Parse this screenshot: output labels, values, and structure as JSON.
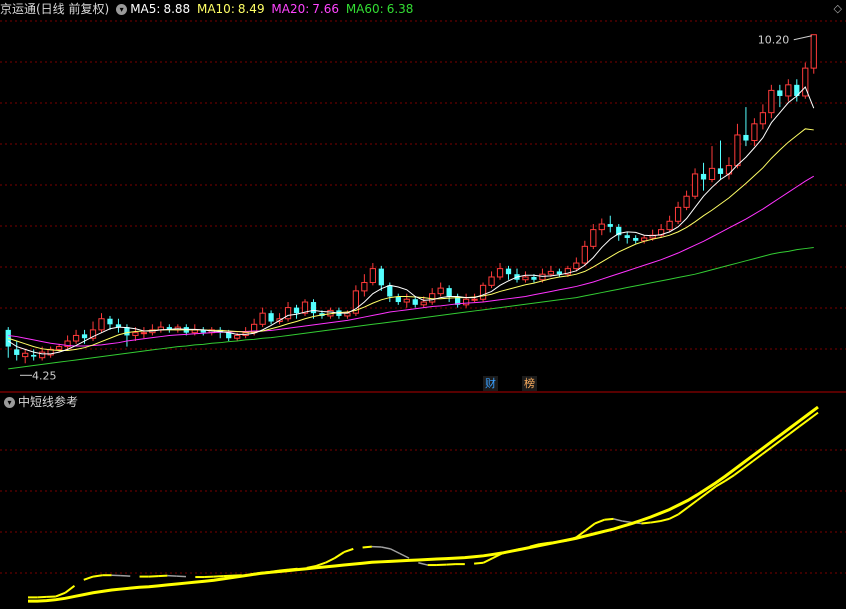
{
  "header": {
    "title": "京运通(日线 前复权)",
    "ma5_label": "MA5:",
    "ma5_value": "8.88",
    "ma10_label": "MA10:",
    "ma10_value": "8.49",
    "ma20_label": "MA20:",
    "ma20_value": "7.66",
    "ma60_label": "MA60:",
    "ma60_value": "6.38"
  },
  "colors": {
    "background": "#000000",
    "up": "#ff3b3b",
    "down": "#54ffff",
    "ma5": "#ffffff",
    "ma10": "#ffff66",
    "ma20": "#ff33ff",
    "ma60": "#33cc33",
    "grid": "#7a0000",
    "indicator_main": "#ffff00",
    "indicator_alt": "#a0a0a0",
    "badge_cai": "#3aa0ff",
    "badge_bang": "#ffb060"
  },
  "price_annotations": {
    "high": "10.20",
    "low": "4.25"
  },
  "badges": {
    "cai": "财",
    "bang": "榜"
  },
  "sub_panel": {
    "title": "中短线参考"
  },
  "icons": {
    "header_toggle": "chevron-down-icon",
    "settings": "diamond-icon",
    "up_arrow": "up-arrow-icon"
  },
  "chart_data": {
    "type": "candlestick",
    "y_range": [
      4.0,
      10.5
    ],
    "candles": [
      [
        4.9,
        4.6,
        4.95,
        4.4
      ],
      [
        4.55,
        4.45,
        4.7,
        4.35
      ],
      [
        4.42,
        4.48,
        4.55,
        4.3
      ],
      [
        4.45,
        4.42,
        4.55,
        4.35
      ],
      [
        4.4,
        4.5,
        4.6,
        4.35
      ],
      [
        4.45,
        4.55,
        4.6,
        4.4
      ],
      [
        4.55,
        4.6,
        4.65,
        4.5
      ],
      [
        4.6,
        4.7,
        4.8,
        4.55
      ],
      [
        4.7,
        4.8,
        4.9,
        4.65
      ],
      [
        4.82,
        4.75,
        4.9,
        4.65
      ],
      [
        4.75,
        4.9,
        5.05,
        4.7
      ],
      [
        4.9,
        5.1,
        5.2,
        4.85
      ],
      [
        5.1,
        5.0,
        5.15,
        4.9
      ],
      [
        5.0,
        4.95,
        5.1,
        4.85
      ],
      [
        4.95,
        4.8,
        5.0,
        4.6
      ],
      [
        4.8,
        4.85,
        4.95,
        4.7
      ],
      [
        4.85,
        4.85,
        4.95,
        4.75
      ],
      [
        4.85,
        4.9,
        5.0,
        4.8
      ],
      [
        4.9,
        4.95,
        5.05,
        4.85
      ],
      [
        4.95,
        4.9,
        5.0,
        4.85
      ],
      [
        4.9,
        4.95,
        5.0,
        4.85
      ],
      [
        4.95,
        4.85,
        5.0,
        4.8
      ],
      [
        4.85,
        4.9,
        5.0,
        4.8
      ],
      [
        4.9,
        4.85,
        4.95,
        4.8
      ],
      [
        4.85,
        4.9,
        4.95,
        4.8
      ],
      [
        4.9,
        4.85,
        4.95,
        4.75
      ],
      [
        4.85,
        4.75,
        4.9,
        4.7
      ],
      [
        4.75,
        4.8,
        4.85,
        4.7
      ],
      [
        4.8,
        4.85,
        4.95,
        4.75
      ],
      [
        4.85,
        5.0,
        5.1,
        4.8
      ],
      [
        5.0,
        5.2,
        5.3,
        4.95
      ],
      [
        5.2,
        5.05,
        5.25,
        5.0
      ],
      [
        5.05,
        5.1,
        5.2,
        5.0
      ],
      [
        5.1,
        5.3,
        5.4,
        5.05
      ],
      [
        5.3,
        5.2,
        5.35,
        5.1
      ],
      [
        5.2,
        5.4,
        5.45,
        5.15
      ],
      [
        5.4,
        5.2,
        5.45,
        5.1
      ],
      [
        5.2,
        5.15,
        5.25,
        5.1
      ],
      [
        5.15,
        5.25,
        5.3,
        5.1
      ],
      [
        5.25,
        5.15,
        5.3,
        5.1
      ],
      [
        5.15,
        5.2,
        5.25,
        5.1
      ],
      [
        5.2,
        5.6,
        5.7,
        5.15
      ],
      [
        5.6,
        5.75,
        5.9,
        5.5
      ],
      [
        5.75,
        6.0,
        6.1,
        5.7
      ],
      [
        6.0,
        5.7,
        6.05,
        5.6
      ],
      [
        5.7,
        5.5,
        5.75,
        5.4
      ],
      [
        5.5,
        5.4,
        5.55,
        5.35
      ],
      [
        5.4,
        5.45,
        5.55,
        5.3
      ],
      [
        5.45,
        5.35,
        5.5,
        5.3
      ],
      [
        5.35,
        5.4,
        5.5,
        5.3
      ],
      [
        5.4,
        5.55,
        5.65,
        5.35
      ],
      [
        5.55,
        5.65,
        5.75,
        5.5
      ],
      [
        5.65,
        5.5,
        5.7,
        5.4
      ],
      [
        5.5,
        5.35,
        5.55,
        5.3
      ],
      [
        5.35,
        5.45,
        5.55,
        5.3
      ],
      [
        5.45,
        5.45,
        5.55,
        5.4
      ],
      [
        5.45,
        5.7,
        5.75,
        5.4
      ],
      [
        5.7,
        5.85,
        5.95,
        5.65
      ],
      [
        5.85,
        6.0,
        6.1,
        5.8
      ],
      [
        6.0,
        5.9,
        6.05,
        5.8
      ],
      [
        5.9,
        5.8,
        6.0,
        5.75
      ],
      [
        5.8,
        5.85,
        5.95,
        5.75
      ],
      [
        5.85,
        5.8,
        5.9,
        5.75
      ],
      [
        5.8,
        5.9,
        6.0,
        5.75
      ],
      [
        5.9,
        5.95,
        6.05,
        5.85
      ],
      [
        5.95,
        5.9,
        6.0,
        5.85
      ],
      [
        5.9,
        6.0,
        6.05,
        5.85
      ],
      [
        6.0,
        6.1,
        6.2,
        5.95
      ],
      [
        6.1,
        6.4,
        6.5,
        6.05
      ],
      [
        6.4,
        6.7,
        6.8,
        6.35
      ],
      [
        6.7,
        6.8,
        6.9,
        6.6
      ],
      [
        6.8,
        6.75,
        6.95,
        6.65
      ],
      [
        6.75,
        6.6,
        6.8,
        6.5
      ],
      [
        6.6,
        6.55,
        6.65,
        6.45
      ],
      [
        6.55,
        6.5,
        6.6,
        6.45
      ],
      [
        6.5,
        6.55,
        6.6,
        6.45
      ],
      [
        6.55,
        6.6,
        6.7,
        6.5
      ],
      [
        6.6,
        6.7,
        6.8,
        6.55
      ],
      [
        6.7,
        6.85,
        6.95,
        6.65
      ],
      [
        6.85,
        7.1,
        7.2,
        6.8
      ],
      [
        7.1,
        7.3,
        7.4,
        7.05
      ],
      [
        7.3,
        7.7,
        7.8,
        7.25
      ],
      [
        7.7,
        7.6,
        7.9,
        7.4
      ],
      [
        7.6,
        7.8,
        8.2,
        7.55
      ],
      [
        7.8,
        7.7,
        8.3,
        7.6
      ],
      [
        7.7,
        7.85,
        8.0,
        7.6
      ],
      [
        7.85,
        8.4,
        8.6,
        7.8
      ],
      [
        8.4,
        8.3,
        8.9,
        8.2
      ],
      [
        8.3,
        8.6,
        8.7,
        8.2
      ],
      [
        8.6,
        8.8,
        8.95,
        8.5
      ],
      [
        8.8,
        9.2,
        9.3,
        8.7
      ],
      [
        9.2,
        9.1,
        9.3,
        8.9
      ],
      [
        9.1,
        9.3,
        9.4,
        9.0
      ],
      [
        9.3,
        9.1,
        9.4,
        9.0
      ],
      [
        9.1,
        9.6,
        9.7,
        9.05
      ],
      [
        9.6,
        10.2,
        10.2,
        9.5
      ]
    ],
    "ma5": [
      4.7,
      4.6,
      4.55,
      4.5,
      4.47,
      4.47,
      4.5,
      4.55,
      4.62,
      4.7,
      4.78,
      4.85,
      4.92,
      4.95,
      4.94,
      4.92,
      4.88,
      4.88,
      4.9,
      4.91,
      4.92,
      4.91,
      4.91,
      4.9,
      4.88,
      4.87,
      4.85,
      4.82,
      4.82,
      4.84,
      4.9,
      4.98,
      5.07,
      5.16,
      5.18,
      5.22,
      5.25,
      5.23,
      5.22,
      5.2,
      5.2,
      5.28,
      5.4,
      5.55,
      5.64,
      5.7,
      5.67,
      5.62,
      5.5,
      5.43,
      5.44,
      5.48,
      5.5,
      5.5,
      5.48,
      5.48,
      5.53,
      5.59,
      5.7,
      5.78,
      5.85,
      5.88,
      5.88,
      5.86,
      5.87,
      5.89,
      5.92,
      5.96,
      6.06,
      6.2,
      6.38,
      6.53,
      6.63,
      6.66,
      6.65,
      6.6,
      6.59,
      6.61,
      6.66,
      6.75,
      6.9,
      7.1,
      7.3,
      7.46,
      7.6,
      7.7,
      7.86,
      8.0,
      8.17,
      8.35,
      8.62,
      8.8,
      8.98,
      9.1,
      9.26,
      8.88
    ],
    "ma10": [
      4.75,
      4.7,
      4.65,
      4.6,
      4.56,
      4.54,
      4.53,
      4.53,
      4.55,
      4.58,
      4.63,
      4.69,
      4.75,
      4.81,
      4.85,
      4.87,
      4.88,
      4.89,
      4.9,
      4.9,
      4.9,
      4.9,
      4.9,
      4.9,
      4.89,
      4.89,
      4.88,
      4.87,
      4.86,
      4.86,
      4.88,
      4.92,
      4.96,
      5.01,
      5.05,
      5.1,
      5.14,
      5.17,
      5.19,
      5.21,
      5.22,
      5.25,
      5.31,
      5.38,
      5.44,
      5.48,
      5.5,
      5.5,
      5.49,
      5.48,
      5.46,
      5.46,
      5.47,
      5.48,
      5.48,
      5.49,
      5.51,
      5.54,
      5.59,
      5.63,
      5.67,
      5.71,
      5.74,
      5.78,
      5.82,
      5.85,
      5.87,
      5.9,
      5.95,
      6.03,
      6.12,
      6.21,
      6.3,
      6.37,
      6.44,
      6.49,
      6.53,
      6.56,
      6.6,
      6.66,
      6.74,
      6.84,
      6.95,
      7.05,
      7.16,
      7.27,
      7.4,
      7.53,
      7.67,
      7.81,
      7.98,
      8.13,
      8.27,
      8.39,
      8.51,
      8.49
    ],
    "ma20": [
      4.8,
      4.78,
      4.75,
      4.72,
      4.69,
      4.66,
      4.64,
      4.62,
      4.61,
      4.61,
      4.62,
      4.63,
      4.65,
      4.67,
      4.7,
      4.72,
      4.74,
      4.76,
      4.78,
      4.8,
      4.81,
      4.82,
      4.83,
      4.84,
      4.85,
      4.86,
      4.86,
      4.87,
      4.87,
      4.88,
      4.88,
      4.89,
      4.91,
      4.93,
      4.95,
      4.97,
      4.99,
      5.01,
      5.03,
      5.05,
      5.07,
      5.1,
      5.13,
      5.16,
      5.19,
      5.22,
      5.24,
      5.26,
      5.28,
      5.3,
      5.32,
      5.33,
      5.35,
      5.37,
      5.38,
      5.39,
      5.4,
      5.42,
      5.44,
      5.46,
      5.48,
      5.5,
      5.53,
      5.56,
      5.59,
      5.62,
      5.65,
      5.68,
      5.72,
      5.76,
      5.81,
      5.86,
      5.91,
      5.96,
      6.01,
      6.06,
      6.11,
      6.16,
      6.22,
      6.28,
      6.35,
      6.42,
      6.49,
      6.57,
      6.65,
      6.73,
      6.81,
      6.89,
      6.98,
      7.07,
      7.17,
      7.27,
      7.37,
      7.47,
      7.57,
      7.66
    ],
    "ma60": [
      4.2,
      4.22,
      4.24,
      4.26,
      4.28,
      4.3,
      4.32,
      4.34,
      4.36,
      4.38,
      4.4,
      4.42,
      4.44,
      4.46,
      4.48,
      4.5,
      4.52,
      4.54,
      4.56,
      4.58,
      4.6,
      4.61,
      4.63,
      4.64,
      4.66,
      4.67,
      4.69,
      4.7,
      4.72,
      4.73,
      4.75,
      4.76,
      4.78,
      4.8,
      4.82,
      4.84,
      4.86,
      4.88,
      4.9,
      4.92,
      4.94,
      4.96,
      4.98,
      5.0,
      5.02,
      5.04,
      5.06,
      5.08,
      5.1,
      5.12,
      5.14,
      5.16,
      5.18,
      5.2,
      5.22,
      5.24,
      5.26,
      5.28,
      5.3,
      5.32,
      5.34,
      5.36,
      5.38,
      5.4,
      5.42,
      5.44,
      5.46,
      5.48,
      5.51,
      5.54,
      5.57,
      5.6,
      5.63,
      5.66,
      5.69,
      5.72,
      5.75,
      5.78,
      5.81,
      5.84,
      5.87,
      5.9,
      5.94,
      5.98,
      6.02,
      6.06,
      6.1,
      6.14,
      6.18,
      6.22,
      6.26,
      6.29,
      6.31,
      6.34,
      6.36,
      6.38
    ],
    "indicator_upper": [
      0.1,
      0.1,
      0.11,
      0.12,
      0.2,
      0.35,
      0.48,
      0.55,
      0.58,
      0.58,
      0.57,
      0.56,
      0.55,
      0.55,
      0.56,
      0.57,
      0.56,
      0.55,
      0.54,
      0.54,
      0.55,
      0.56,
      0.57,
      0.58,
      0.6,
      0.63,
      0.65,
      0.68,
      0.7,
      0.72,
      0.74,
      0.78,
      0.85,
      0.95,
      1.08,
      1.15,
      1.18,
      1.2,
      1.19,
      1.15,
      1.05,
      0.95,
      0.85,
      0.8,
      0.8,
      0.81,
      0.82,
      0.82,
      0.83,
      0.85,
      0.95,
      1.05,
      1.1,
      1.15,
      1.2,
      1.25,
      1.28,
      1.3,
      1.33,
      1.4,
      1.55,
      1.7,
      1.78,
      1.8,
      1.75,
      1.72,
      1.7,
      1.72,
      1.75,
      1.8,
      1.9,
      2.05,
      2.2,
      2.35,
      2.5,
      2.62,
      2.75,
      2.9,
      3.05,
      3.2,
      3.35,
      3.5,
      3.65,
      3.8,
      3.95,
      4.1
    ],
    "indicator_lower": [
      0.02,
      0.02,
      0.03,
      0.05,
      0.08,
      0.12,
      0.16,
      0.2,
      0.23,
      0.26,
      0.28,
      0.3,
      0.32,
      0.33,
      0.35,
      0.37,
      0.39,
      0.41,
      0.43,
      0.45,
      0.47,
      0.5,
      0.53,
      0.56,
      0.59,
      0.62,
      0.64,
      0.66,
      0.68,
      0.7,
      0.72,
      0.74,
      0.76,
      0.78,
      0.8,
      0.82,
      0.84,
      0.86,
      0.87,
      0.88,
      0.89,
      0.9,
      0.91,
      0.92,
      0.93,
      0.94,
      0.95,
      0.96,
      0.98,
      1.0,
      1.03,
      1.06,
      1.1,
      1.14,
      1.18,
      1.22,
      1.26,
      1.3,
      1.34,
      1.38,
      1.43,
      1.48,
      1.53,
      1.58,
      1.64,
      1.7,
      1.77,
      1.84,
      1.92,
      2.0,
      2.1,
      2.2,
      2.32,
      2.45,
      2.58,
      2.72,
      2.87,
      3.02,
      3.17,
      3.32,
      3.47,
      3.62,
      3.77,
      3.92,
      4.07,
      4.22
    ]
  }
}
